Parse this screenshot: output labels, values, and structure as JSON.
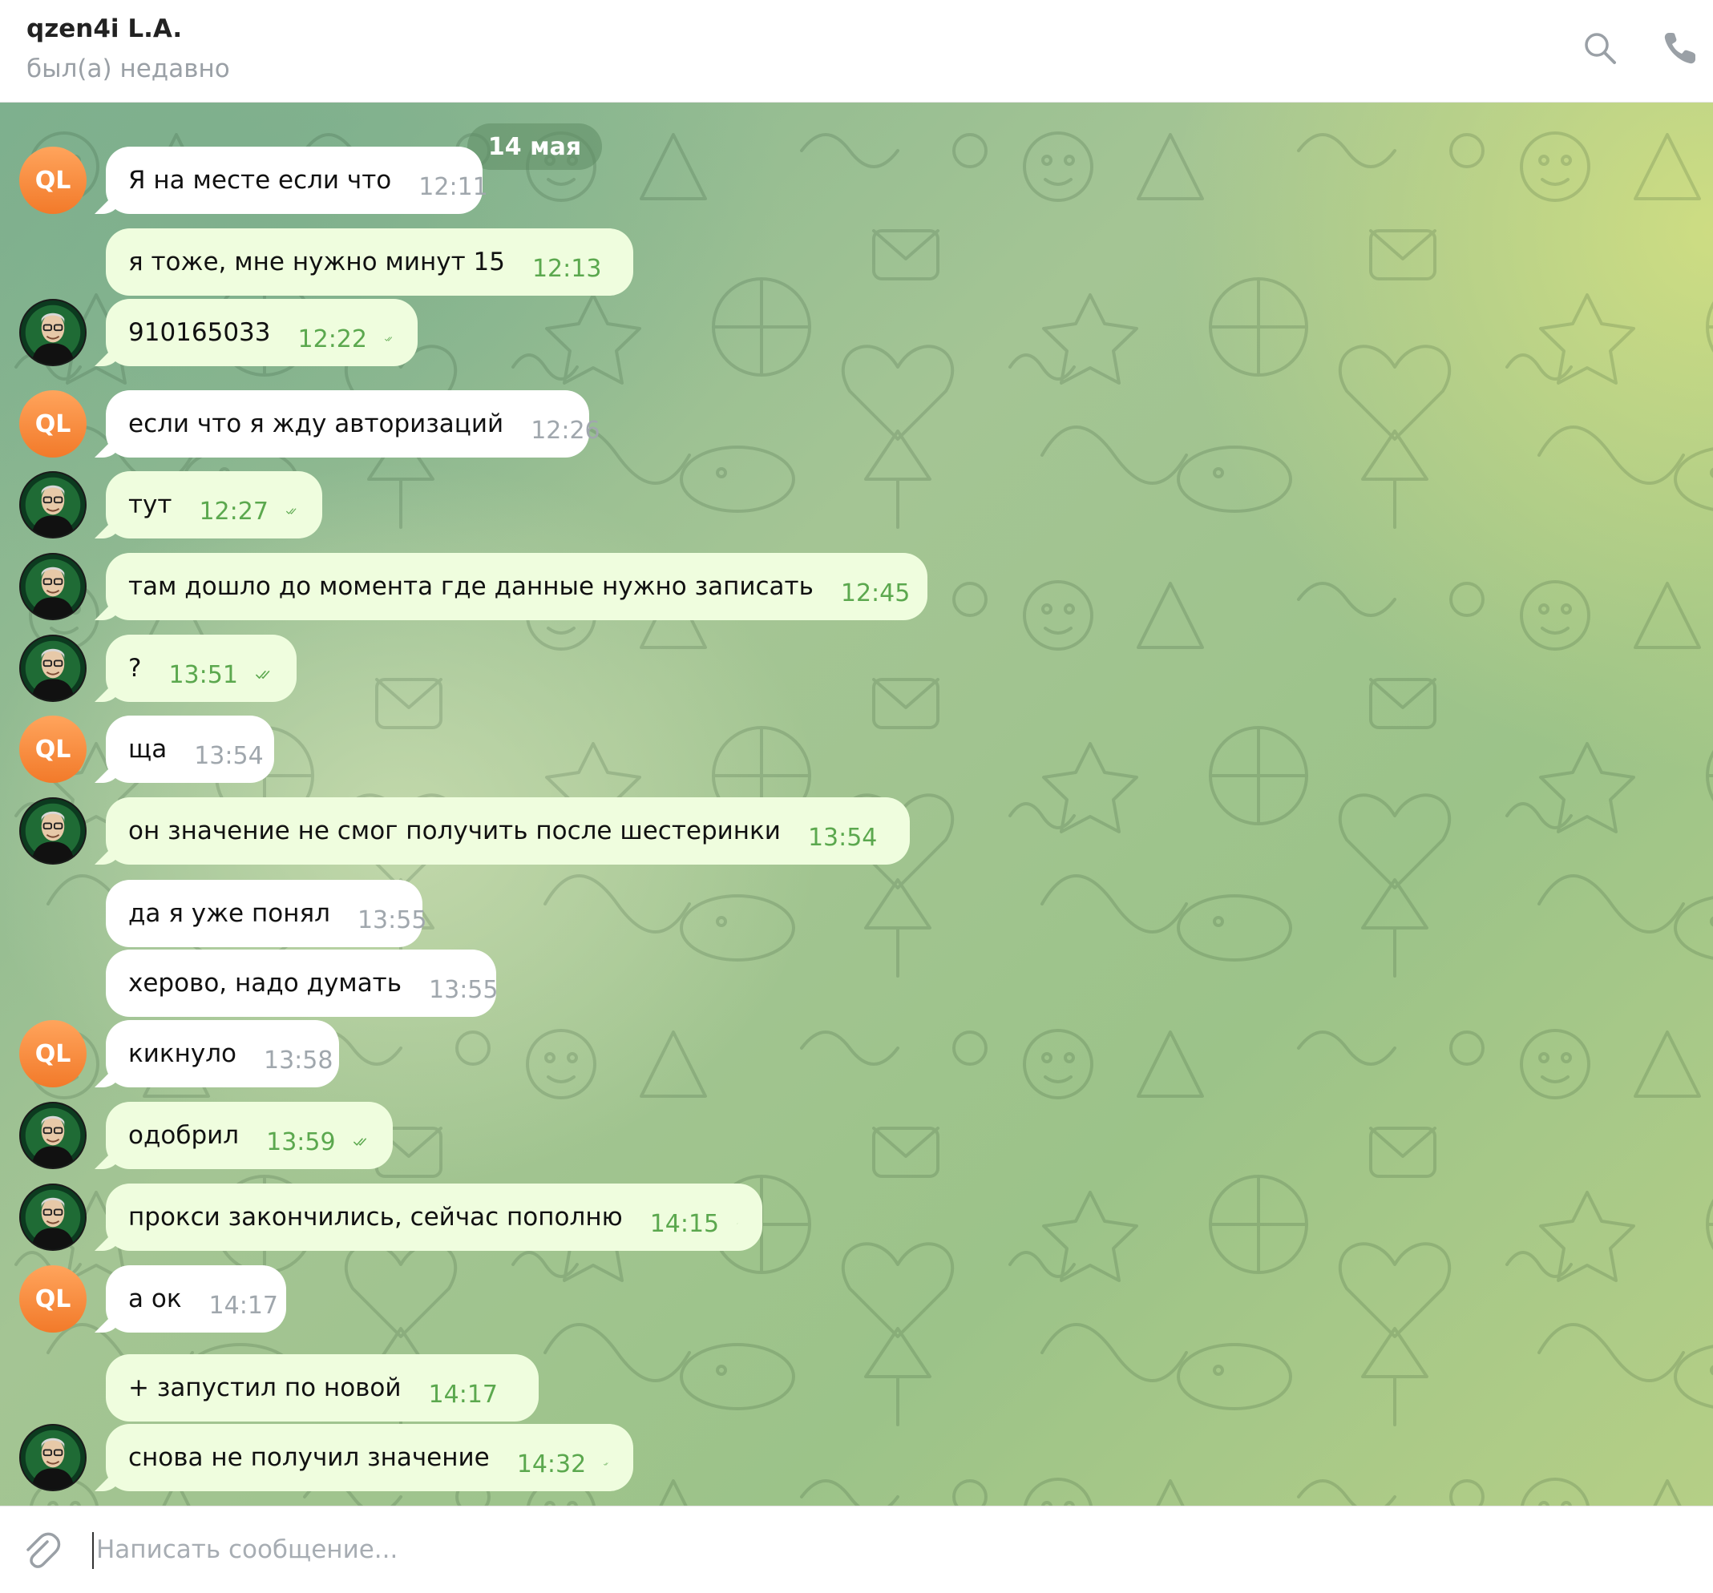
{
  "header": {
    "peer_name": "qzen4i L.A.",
    "peer_status": "был(а) недавно",
    "search_icon": "search-icon",
    "call_icon": "phone-icon"
  },
  "chat": {
    "date_label": "14 мая",
    "incoming_avatar_text": "QL",
    "messages": [
      {
        "dir": "in",
        "text": "Я на месте если что",
        "time": "12:11"
      },
      {
        "dir": "out",
        "text": "я тоже, мне нужно минут 15",
        "time": "12:13",
        "read": true
      },
      {
        "dir": "out",
        "text": "910165033",
        "time": "12:22",
        "read": true
      },
      {
        "dir": "in",
        "text": "если что я жду авторизаций",
        "time": "12:26"
      },
      {
        "dir": "out",
        "text": "тут",
        "time": "12:27",
        "read": true
      },
      {
        "dir": "out",
        "text": "там дошло до момента где данные нужно записать",
        "time": "12:45",
        "read": true
      },
      {
        "dir": "out",
        "text": "?",
        "time": "13:51",
        "read": true
      },
      {
        "dir": "in",
        "text": "ща",
        "time": "13:54"
      },
      {
        "dir": "out",
        "text": "он значение не смог получить после шестеринки",
        "time": "13:54",
        "read": true
      },
      {
        "dir": "in",
        "text": "да я уже понял",
        "time": "13:55"
      },
      {
        "dir": "in",
        "text": "херово, надо думать",
        "time": "13:55"
      },
      {
        "dir": "in",
        "text": "кикнуло",
        "time": "13:58"
      },
      {
        "dir": "out",
        "text": "одобрил",
        "time": "13:59",
        "read": true
      },
      {
        "dir": "out",
        "text": "прокси закончились, сейчас пополню",
        "time": "14:15",
        "read": true
      },
      {
        "dir": "in",
        "text": "а ок",
        "time": "14:17"
      },
      {
        "dir": "out",
        "text": "+ запустил по новой",
        "time": "14:17",
        "read": true
      },
      {
        "dir": "out",
        "text": "снова не получил значение",
        "time": "14:32",
        "read": true
      }
    ]
  },
  "composer": {
    "placeholder": "Написать сообщение...",
    "value": "",
    "attach_icon": "paperclip-icon"
  },
  "colors": {
    "incoming_bubble": "#ffffff",
    "outgoing_bubble": "#effdde",
    "outgoing_time": "#5ba84e",
    "avatar_orange": "#f58a3c"
  }
}
